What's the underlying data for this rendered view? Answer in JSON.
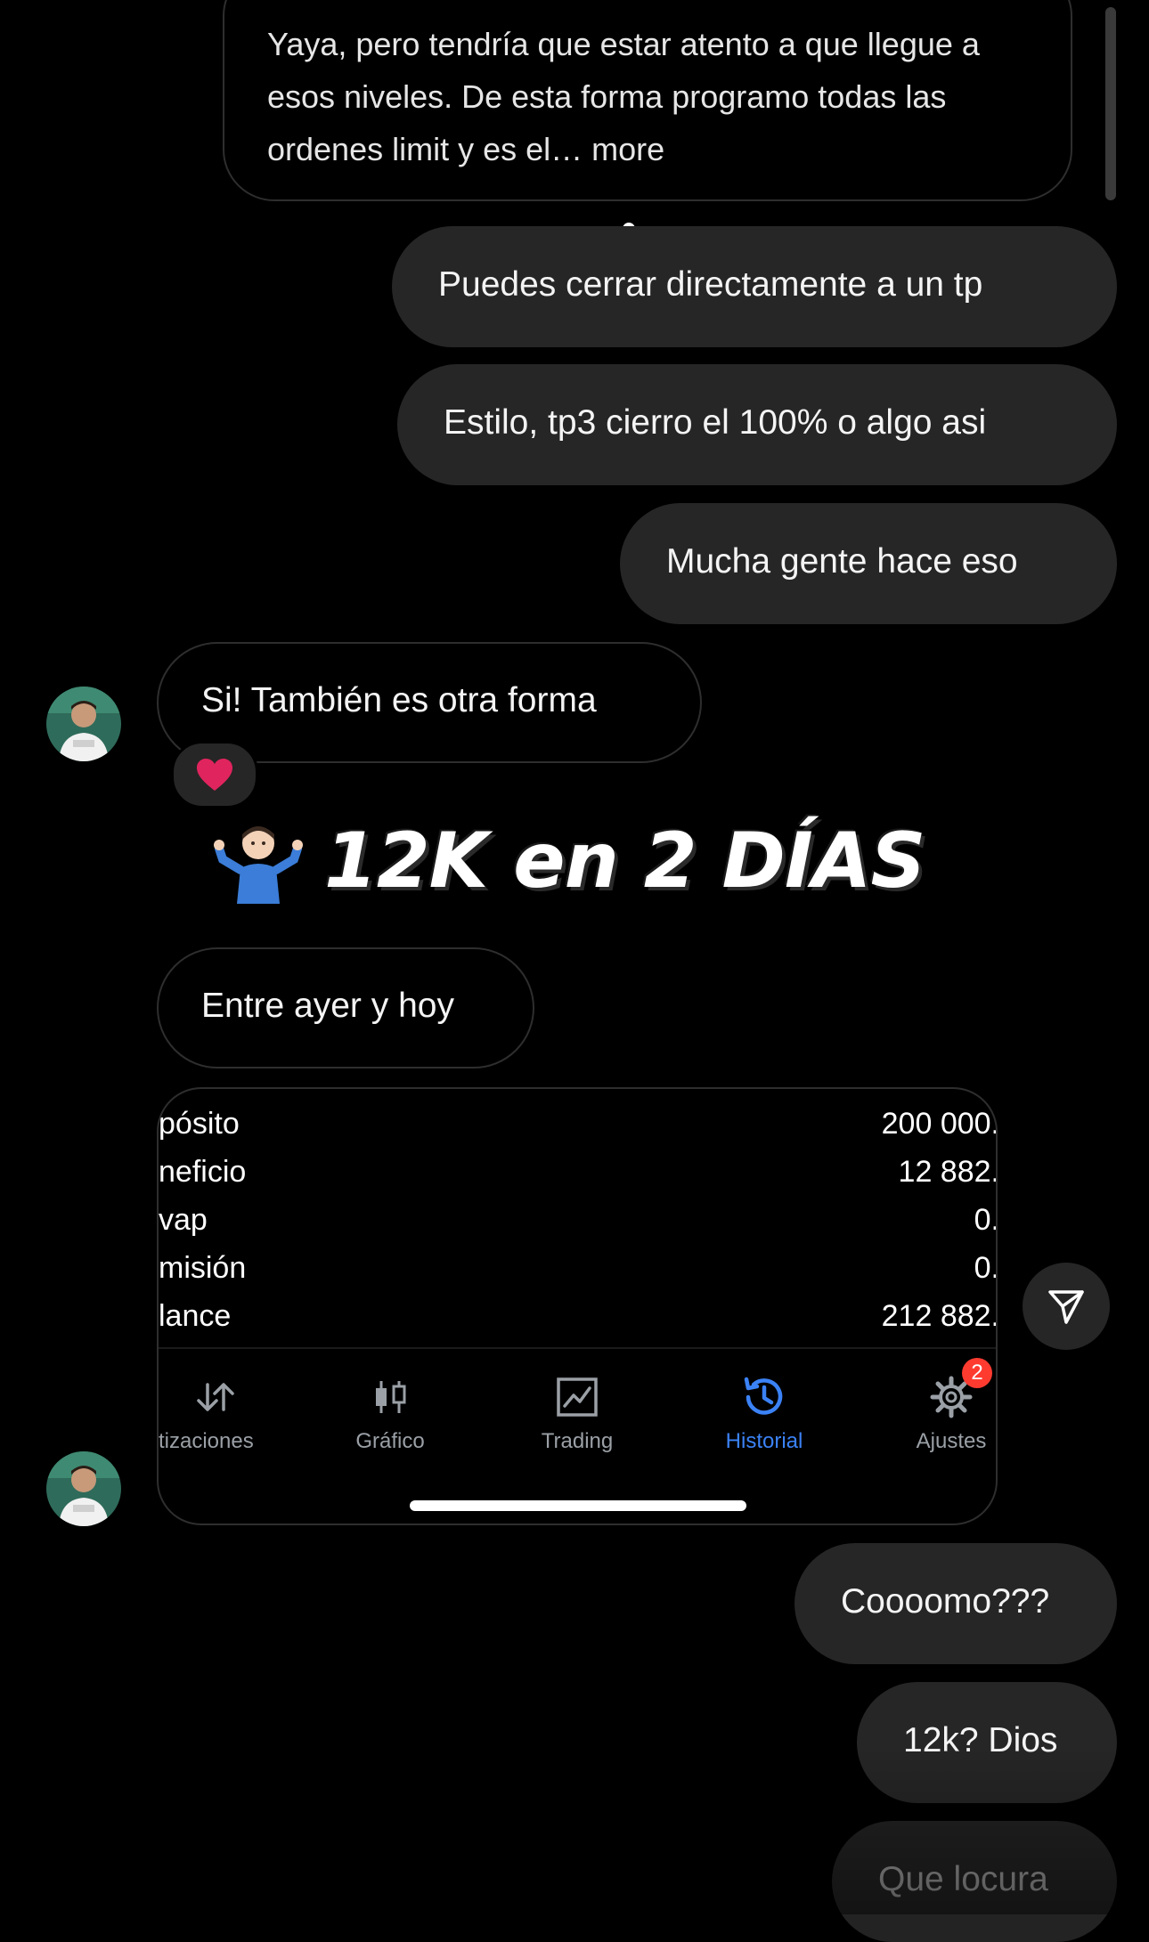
{
  "messages": {
    "top_incoming_text": "Yaya, pero tendría que estar atento a que llegue a esos niveles. De esta forma programo todas las ordenes limit y es el… more",
    "outgoing_1": "Puedes cerrar directamente a un tp",
    "outgoing_2": "Estilo, tp3 cierro el 100% o algo asi",
    "outgoing_3": "Mucha gente hace eso",
    "incoming_1": "Si! También es otra forma",
    "incoming_2": "Entre ayer y hoy",
    "outgoing_4": "Coooomo???",
    "outgoing_5": "12k? Dios",
    "outgoing_6": "Que locura"
  },
  "reaction": {
    "icon": "heart-icon",
    "color": "#e0245e"
  },
  "caption": {
    "emoji": "person-shrugging-emoji",
    "text": "12K en 2 DÍAS"
  },
  "screenshot": {
    "rows": [
      {
        "label": "pósito",
        "value": "200 000."
      },
      {
        "label": "neficio",
        "value": "12 882."
      },
      {
        "label": "vap",
        "value": "0."
      },
      {
        "label": "misión",
        "value": "0."
      },
      {
        "label": "lance",
        "value": "212 882."
      }
    ],
    "tabs": [
      {
        "label": "tizaciones",
        "icon": "arrows-up-down-icon"
      },
      {
        "label": "Gráfico",
        "icon": "candlestick-icon"
      },
      {
        "label": "Trading",
        "icon": "trading-chart-icon"
      },
      {
        "label": "Historial",
        "icon": "history-clock-icon",
        "active": true
      },
      {
        "label": "Ajustes",
        "icon": "gear-icon",
        "badge": "2"
      }
    ],
    "active_color": "#3b82f6",
    "badge_color": "#ff3b30"
  },
  "actions": {
    "share_icon": "send-icon"
  }
}
